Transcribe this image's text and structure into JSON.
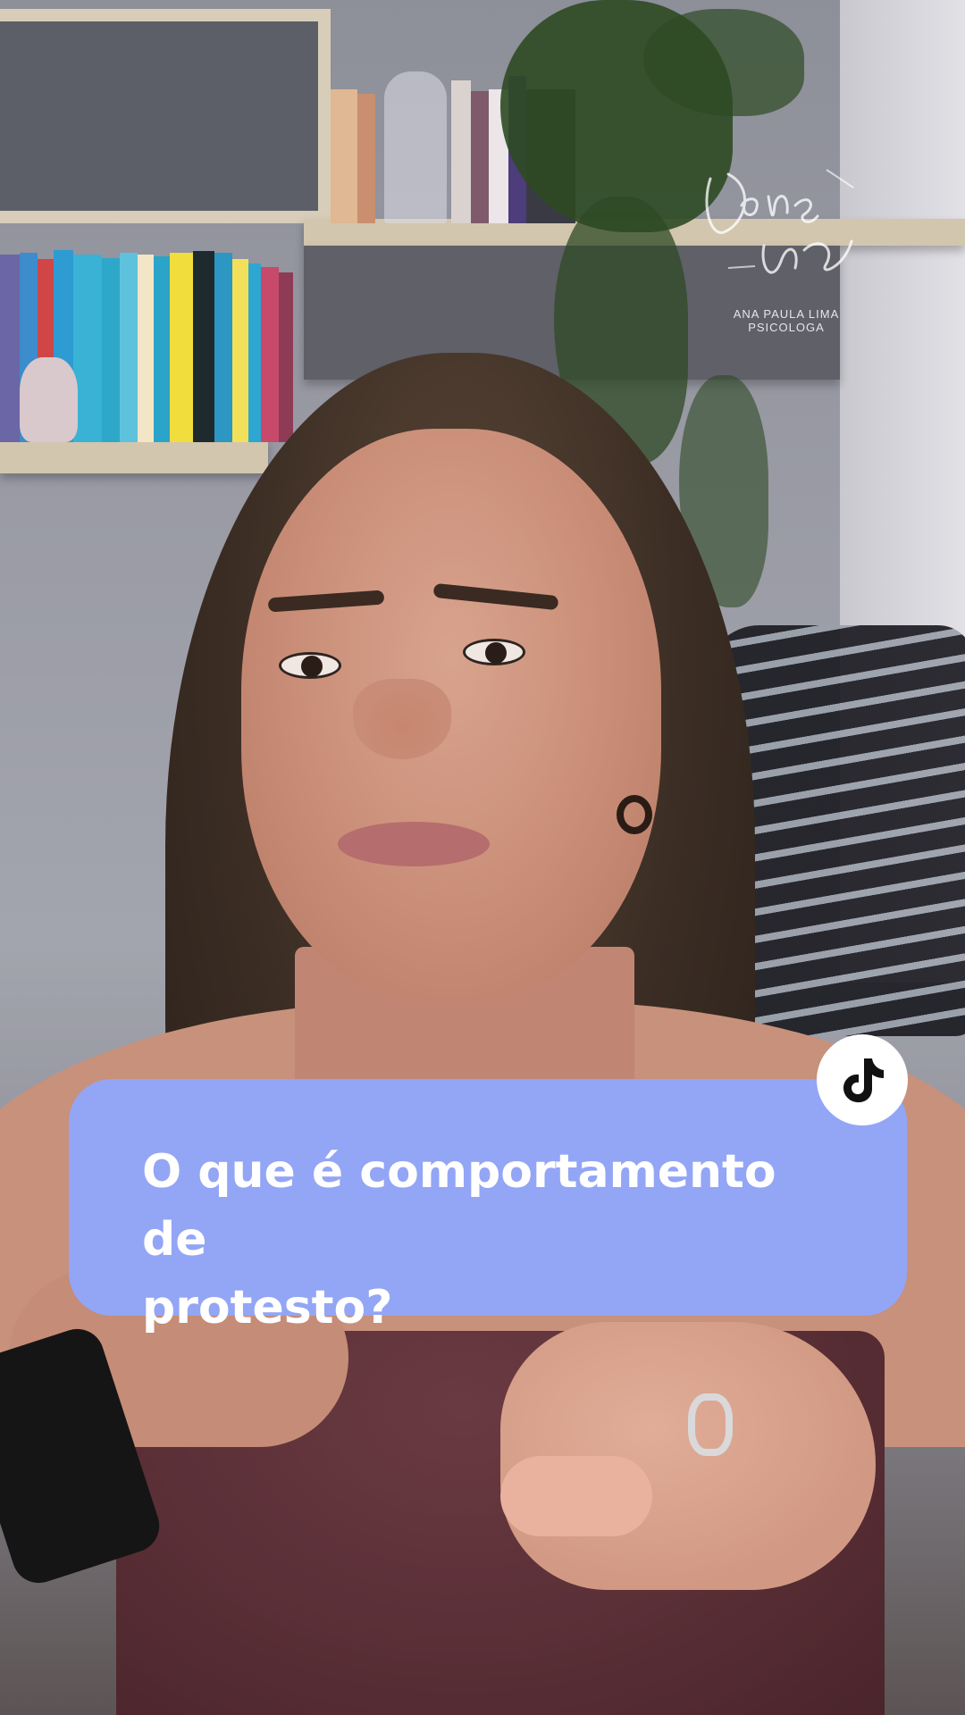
{
  "watermark": {
    "signature_script": "Dona Amor",
    "caption": "ANA PAULA LIMA PSICOLOGA"
  },
  "question_card": {
    "text_line1": "O que é comportamento de",
    "text_line2": "protesto?",
    "background_color": "#93a5f5",
    "text_color": "#ffffff"
  },
  "badge": {
    "icon": "tiktok-icon"
  }
}
